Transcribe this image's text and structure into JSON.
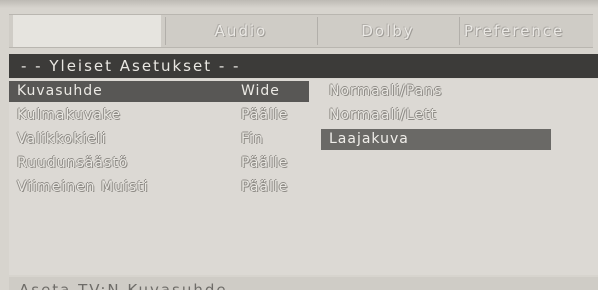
{
  "tabs": [
    {
      "label": "",
      "selected": true
    },
    {
      "label": "Audio",
      "selected": false
    },
    {
      "label": "Dolby",
      "selected": false
    },
    {
      "label": "Preference",
      "selected": false
    }
  ],
  "section_title": "- -  Yleiset  Asetukset  - -",
  "settings": [
    {
      "label": "Kuvasuhde",
      "value": "Wide"
    },
    {
      "label": "Kulmakuvake",
      "value": "Päälle"
    },
    {
      "label": "Valikkokieli",
      "value": "Fin"
    },
    {
      "label": "Ruudunsäästö",
      "value": "Päälle"
    },
    {
      "label": "Viimeinen  Muisti",
      "value": "Päälle"
    }
  ],
  "options": [
    {
      "label": "Normaali/Pans",
      "selected": false
    },
    {
      "label": "Normaali/Lett",
      "selected": false
    },
    {
      "label": "Laajakuva",
      "selected": true
    }
  ],
  "footer_text": "Aseta  TV:N  Kuvasuhde"
}
